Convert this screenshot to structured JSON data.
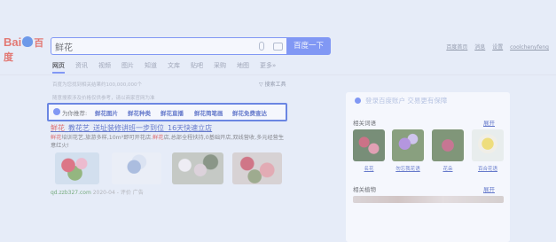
{
  "logo": {
    "bai": "Bai",
    "du": "百度"
  },
  "search": {
    "query": "鲜花",
    "button": "百度一下"
  },
  "top_links": {
    "settings_home": "百度首页",
    "messages": "消息",
    "settings": "设置",
    "user": "coolchenyfeng"
  },
  "tabs": [
    {
      "label": "网页",
      "active": true
    },
    {
      "label": "资讯"
    },
    {
      "label": "视频"
    },
    {
      "label": "图片"
    },
    {
      "label": "知道"
    },
    {
      "label": "文库"
    },
    {
      "label": "贴吧"
    },
    {
      "label": "采购"
    },
    {
      "label": "地图"
    },
    {
      "label": "更多»"
    }
  ],
  "result_count": "百度为您找到相关结果约100,000,000个",
  "search_tools": "搜索工具",
  "hint": "随意搜索涉及价格仅供参考，请以商家官网为准",
  "recommend": {
    "label": "为你推荐:",
    "items": [
      "鲜花图片",
      "鲜花种类",
      "鲜花直播",
      "鲜花简笔画",
      "鲜花免费查达"
    ]
  },
  "result": {
    "title_hl": "鲜花",
    "title_rest": "_教花艺_送址装修讲班一步到位_16天快速立店",
    "desc_hl1": "鲜花",
    "desc_part1": "培训花艺,旅游多样,10m²即可开花店.",
    "desc_hl2": "鲜花",
    "desc_part2": "店,总部全程扶持,0基础开店,双线营收,多元经营生意红火!",
    "site": "qd.zzb327.com",
    "date": "2020-04",
    "evaluate": "评价",
    "ad": "广告"
  },
  "right_panel": {
    "login_tip": "登录百度账户  交易更有保障",
    "related_words": "相关词语",
    "more": "展开",
    "related_plants": "相关植物",
    "more2": "展开",
    "flowers": [
      "名花",
      "勿忘我花语",
      "花朵",
      "百合花语"
    ]
  }
}
